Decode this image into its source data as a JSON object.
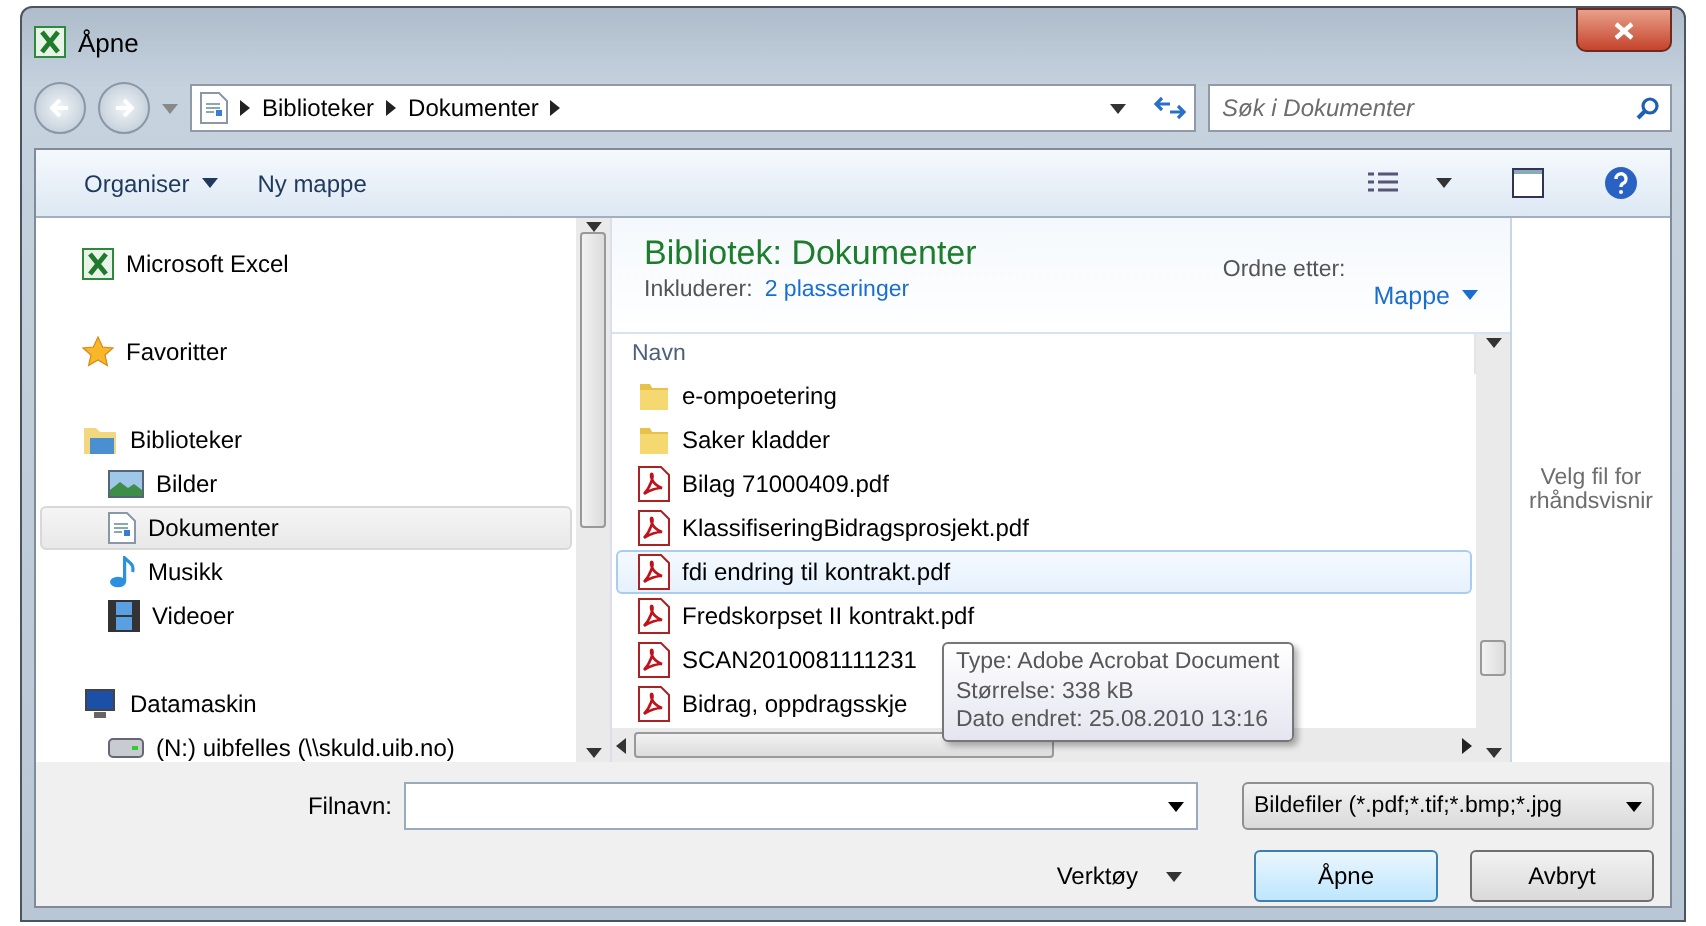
{
  "window": {
    "title": "Åpne"
  },
  "address_bar": {
    "path": [
      "Biblioteker",
      "Dokumenter"
    ]
  },
  "search": {
    "placeholder": "Søk i Dokumenter"
  },
  "toolbar": {
    "buttons": [
      {
        "label": "Organiser",
        "dropdown": true
      },
      {
        "label": "Ny mappe",
        "dropdown": false
      }
    ]
  },
  "sidebar": {
    "items": [
      {
        "label": "Microsoft Excel",
        "kind": "excel",
        "selected": false
      },
      {
        "label": "Favoritter",
        "kind": "star",
        "selected": false
      },
      {
        "label": "Biblioteker",
        "kind": "library",
        "selected": false,
        "children": [
          {
            "label": "Bilder",
            "kind": "pictures",
            "selected": false
          },
          {
            "label": "Dokumenter",
            "kind": "document",
            "selected": true
          },
          {
            "label": "Musikk",
            "kind": "music",
            "selected": false
          },
          {
            "label": "Videoer",
            "kind": "video",
            "selected": false
          }
        ]
      },
      {
        "label": "Datamaskin",
        "kind": "computer",
        "selected": false,
        "children": [
          {
            "label": "(N:) uibfelles (\\\\skuld.uib.no)",
            "kind": "drive",
            "selected": false
          }
        ]
      }
    ]
  },
  "library": {
    "title": "Bibliotek: Dokumenter",
    "includes_label": "Inkluderer:",
    "includes_link": "2 plasseringer",
    "arrange_label": "Ordne etter:",
    "arrange_value": "Mappe"
  },
  "files": {
    "column": "Navn",
    "rows": [
      {
        "name": "e-ompoetering",
        "kind": "folder",
        "selected": false
      },
      {
        "name": "Saker kladder",
        "kind": "folder",
        "selected": false
      },
      {
        "name": "Bilag 71000409.pdf",
        "kind": "pdf",
        "selected": false
      },
      {
        "name": "KlassifiseringBidragsprosjekt.pdf",
        "kind": "pdf",
        "selected": false
      },
      {
        "name": "fdi endring til kontrakt.pdf",
        "kind": "pdf",
        "selected": true
      },
      {
        "name": "Fredskorpset II kontrakt.pdf",
        "kind": "pdf",
        "selected": false
      },
      {
        "name": "SCAN2010081111231",
        "kind": "pdf",
        "selected": false
      },
      {
        "name": "Bidrag, oppdragsskje",
        "kind": "pdf",
        "selected": false
      }
    ]
  },
  "tooltip": {
    "lines": [
      "Type: Adobe Acrobat Document",
      "Størrelse: 338 kB",
      "Dato endret: 25.08.2010 13:16"
    ]
  },
  "preview": {
    "lines": [
      "Velg fil for",
      "rhåndsvisnir"
    ]
  },
  "bottom": {
    "filename_label": "Filnavn:",
    "filter": "Bildefiler (*.pdf;*.tif;*.bmp;*.jpg",
    "tools": "Verktøy",
    "buttons": [
      {
        "label": "Åpne",
        "default": true
      },
      {
        "label": "Avbryt",
        "default": false
      }
    ]
  }
}
